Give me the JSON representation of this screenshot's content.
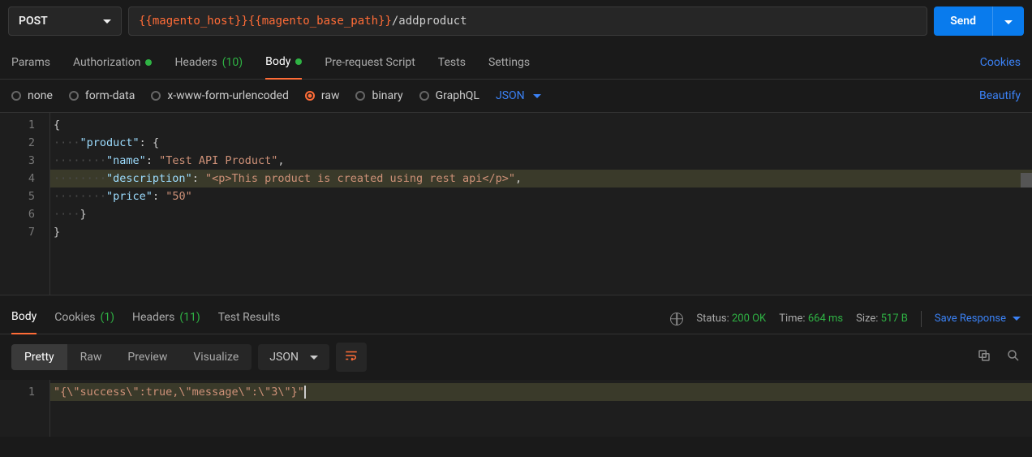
{
  "request": {
    "method": "POST",
    "url_var": "{{magento_host}}{{magento_base_path}}",
    "url_path": "/addproduct",
    "send_label": "Send"
  },
  "tabs": {
    "params": "Params",
    "authorization": "Authorization",
    "headers": "Headers",
    "headers_count": "(10)",
    "body": "Body",
    "prerequest": "Pre-request Script",
    "tests": "Tests",
    "settings": "Settings",
    "cookies_link": "Cookies"
  },
  "body_types": {
    "none": "none",
    "form_data": "form-data",
    "urlencoded": "x-www-form-urlencoded",
    "raw": "raw",
    "binary": "binary",
    "graphql": "GraphQL",
    "format": "JSON",
    "beautify": "Beautify"
  },
  "request_body": {
    "lines": [
      "1",
      "2",
      "3",
      "4",
      "5",
      "6",
      "7"
    ],
    "l1_open": "{",
    "l2_key": "\"product\"",
    "l2_colon": ": ",
    "l2_open": "{",
    "l3_key": "\"name\"",
    "l3_colon": ": ",
    "l3_val": "\"Test API Product\"",
    "l3_comma": ",",
    "l4_key": "\"description\"",
    "l4_colon": ": ",
    "l4_val": "\"<p>This product is created using rest api</p>\"",
    "l4_comma": ",",
    "l5_key": "\"price\"",
    "l5_colon": ": ",
    "l5_val": "\"50\"",
    "l6_close": "}",
    "l7_close": "}"
  },
  "response_tabs": {
    "body": "Body",
    "cookies": "Cookies",
    "cookies_count": "(1)",
    "headers": "Headers",
    "headers_count": "(11)",
    "test_results": "Test Results"
  },
  "response_meta": {
    "status_label": "Status:",
    "status_value": "200 OK",
    "time_label": "Time:",
    "time_value": "664 ms",
    "size_label": "Size:",
    "size_value": "517 B",
    "save_response": "Save Response"
  },
  "response_toolbar": {
    "pretty": "Pretty",
    "raw": "Raw",
    "preview": "Preview",
    "visualize": "Visualize",
    "format": "JSON"
  },
  "response_body": {
    "line_no": "1",
    "content": "\"{\\\"success\\\":true,\\\"message\\\":\\\"3\\\"}\""
  }
}
